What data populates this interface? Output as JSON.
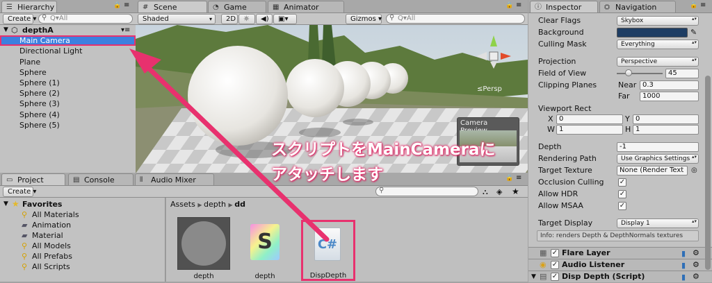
{
  "hierarchy": {
    "tab": "Hierarchy",
    "create": "Create",
    "search": "Q▾All",
    "scene": "depthA",
    "items": [
      "Main Camera",
      "Directional Light",
      "Plane",
      "Sphere",
      "Sphere (1)",
      "Sphere (2)",
      "Sphere (3)",
      "Sphere (4)",
      "Sphere (5)"
    ]
  },
  "scene": {
    "tabs": [
      "Scene",
      "Game",
      "Animator"
    ],
    "shading": "Shaded",
    "mode2d": "2D",
    "gizmos": "Gizmos",
    "search": "Q▾All",
    "persp": "≤Persp",
    "camera_preview": "Camera Preview"
  },
  "project": {
    "tabs": [
      "Project",
      "Console",
      "Audio Mixer"
    ],
    "create": "Create",
    "favorites": "Favorites",
    "fav_items": [
      "All Materials",
      "Animation",
      "Material",
      "All Models",
      "All Prefabs",
      "All Scripts"
    ],
    "breadcrumb": [
      "Assets",
      "depth",
      "dd"
    ],
    "assets": [
      "depth",
      "depth",
      "DispDepth"
    ]
  },
  "inspector": {
    "tabs": [
      "Inspector",
      "Navigation"
    ],
    "rows": {
      "clear_flags": {
        "label": "Clear Flags",
        "value": "Skybox"
      },
      "background": {
        "label": "Background",
        "color": "#1e3d63"
      },
      "culling_mask": {
        "label": "Culling Mask",
        "value": "Everything"
      },
      "projection": {
        "label": "Projection",
        "value": "Perspective"
      },
      "fov": {
        "label": "Field of View",
        "value": "45",
        "slider": 0.25
      },
      "clipping": {
        "label": "Clipping Planes",
        "near_label": "Near",
        "near": "0.3",
        "far_label": "Far",
        "far": "1000"
      },
      "viewport": {
        "label": "Viewport Rect",
        "x_label": "X",
        "x": "0",
        "y_label": "Y",
        "y": "0",
        "w_label": "W",
        "w": "1",
        "h_label": "H",
        "h": "1"
      },
      "depth": {
        "label": "Depth",
        "value": "-1"
      },
      "rendering_path": {
        "label": "Rendering Path",
        "value": "Use Graphics Settings"
      },
      "target_texture": {
        "label": "Target Texture",
        "value": "None (Render Text"
      },
      "occlusion": {
        "label": "Occlusion Culling"
      },
      "hdr": {
        "label": "Allow HDR"
      },
      "msaa": {
        "label": "Allow MSAA"
      },
      "target_display": {
        "label": "Target Display",
        "value": "Display 1"
      }
    },
    "info": "Info: renders Depth & DepthNormals textures",
    "components": [
      "Flare Layer",
      "Audio Listener",
      "Disp Depth (Script)"
    ]
  },
  "annotation": {
    "line1": "スクリプトをMainCameraに",
    "line2": "アタッチします",
    "color": "#e8316e"
  }
}
